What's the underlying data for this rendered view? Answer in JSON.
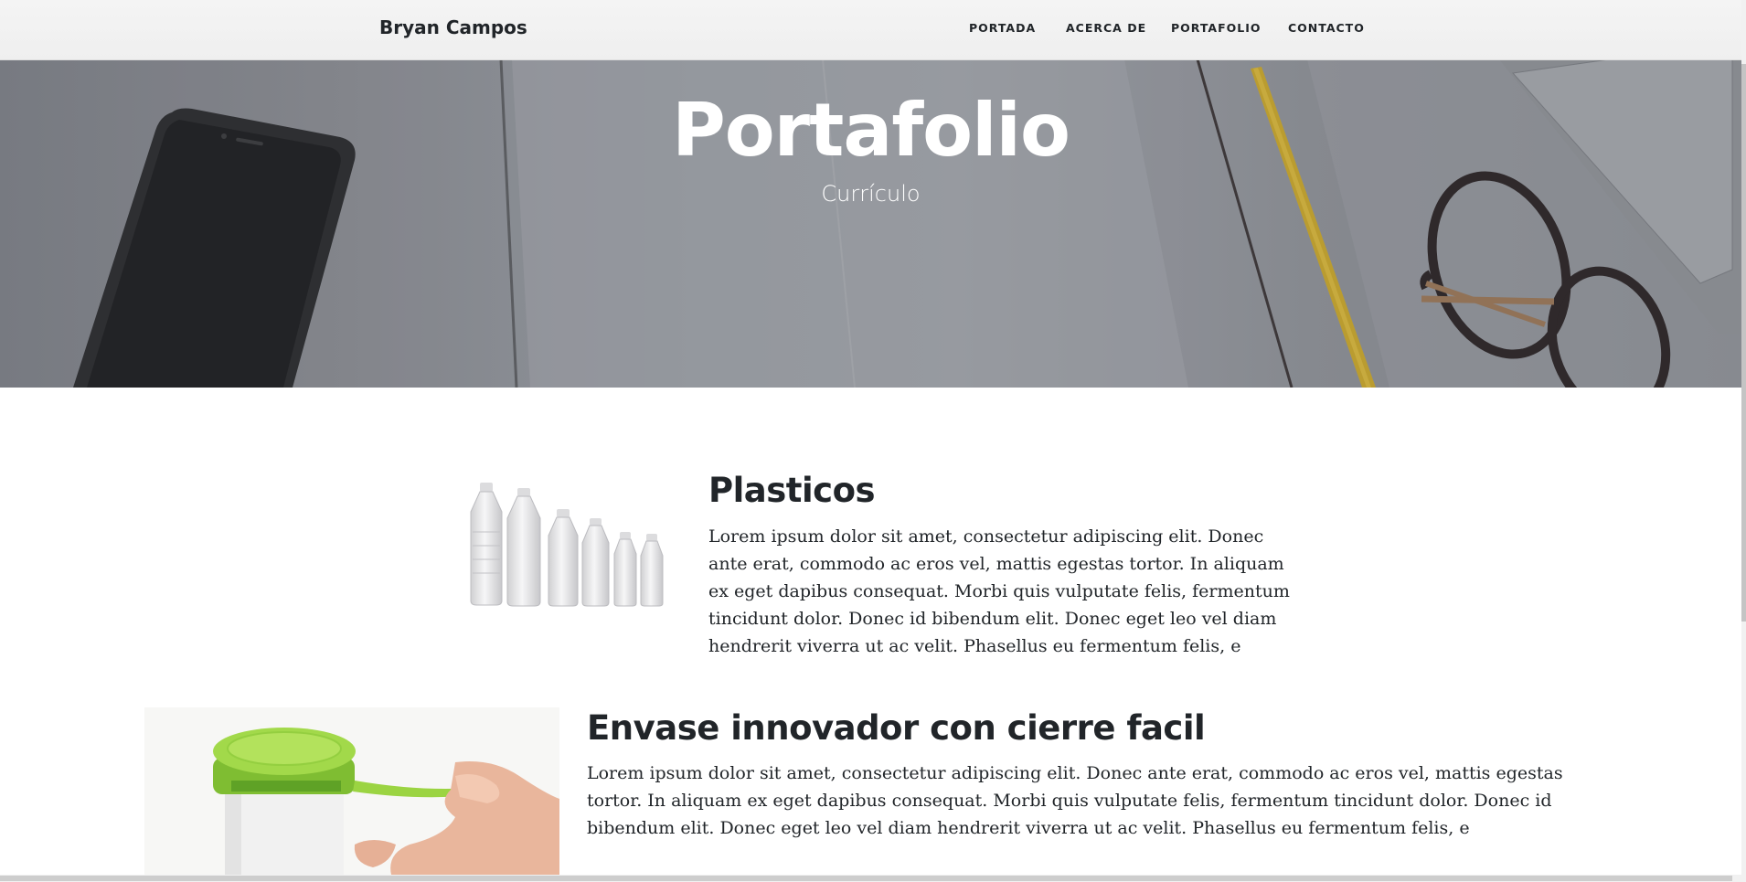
{
  "navbar": {
    "brand": "Bryan Campos",
    "links": [
      "PORTADA",
      "ACERCA DE",
      "PORTAFOLIO",
      "CONTACTO"
    ]
  },
  "hero": {
    "title": "Portafolio",
    "subtitle": "Currículo"
  },
  "items": [
    {
      "title": "Plasticos",
      "text": "Lorem ipsum dolor sit amet, consectetur adipiscing elit. Donec ante erat, commodo ac eros vel, mattis egestas tortor. In aliquam ex eget dapibus consequat. Morbi quis vulputate felis, fermentum tincidunt dolor. Donec id bibendum elit. Donec eget leo vel diam hendrerit viverra ut ac velit. Phasellus eu fermentum felis, e"
    },
    {
      "title": "Envase innovador con cierre facil",
      "text": "Lorem ipsum dolor sit amet, consectetur adipiscing elit. Donec ante erat, commodo ac eros vel, mattis egestas tortor. In aliquam ex eget dapibus consequat. Morbi quis vulputate felis, fermentum tincidunt dolor. Donec id bibendum elit. Donec eget leo vel diam hendrerit viverra ut ac velit. Phasellus eu fermentum felis, e"
    }
  ],
  "colors": {
    "hero_overlay": "#8c8e94",
    "text": "#212529",
    "cap_green": "#8fcf3c"
  },
  "icons": [
    "phone-image",
    "glasses-image",
    "pencil-image",
    "bottles-image",
    "container-image"
  ]
}
